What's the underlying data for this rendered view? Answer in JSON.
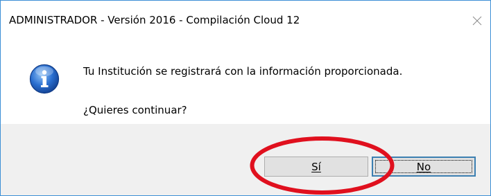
{
  "window": {
    "title": "ADMINISTRADOR - Versión  2016 - Compilación Cloud 12",
    "close_icon": "close-icon"
  },
  "message": {
    "icon": "info-icon",
    "line1": "Tu Institución se registrará con la información proporcionada.",
    "line2": "¿Quieres continuar?"
  },
  "buttons": {
    "yes_label": "Sí",
    "no_label": "No"
  },
  "colors": {
    "border": "#3c8fd6",
    "footer_bg": "#f0f0f0",
    "button_bg": "#e1e1e1",
    "focus_border": "#3c7fb1",
    "highlight_ellipse": "#e0101e",
    "info_icon_blue": "#1f5fb8"
  },
  "annotation": {
    "shape": "red-ellipse",
    "target": "yes-button"
  }
}
